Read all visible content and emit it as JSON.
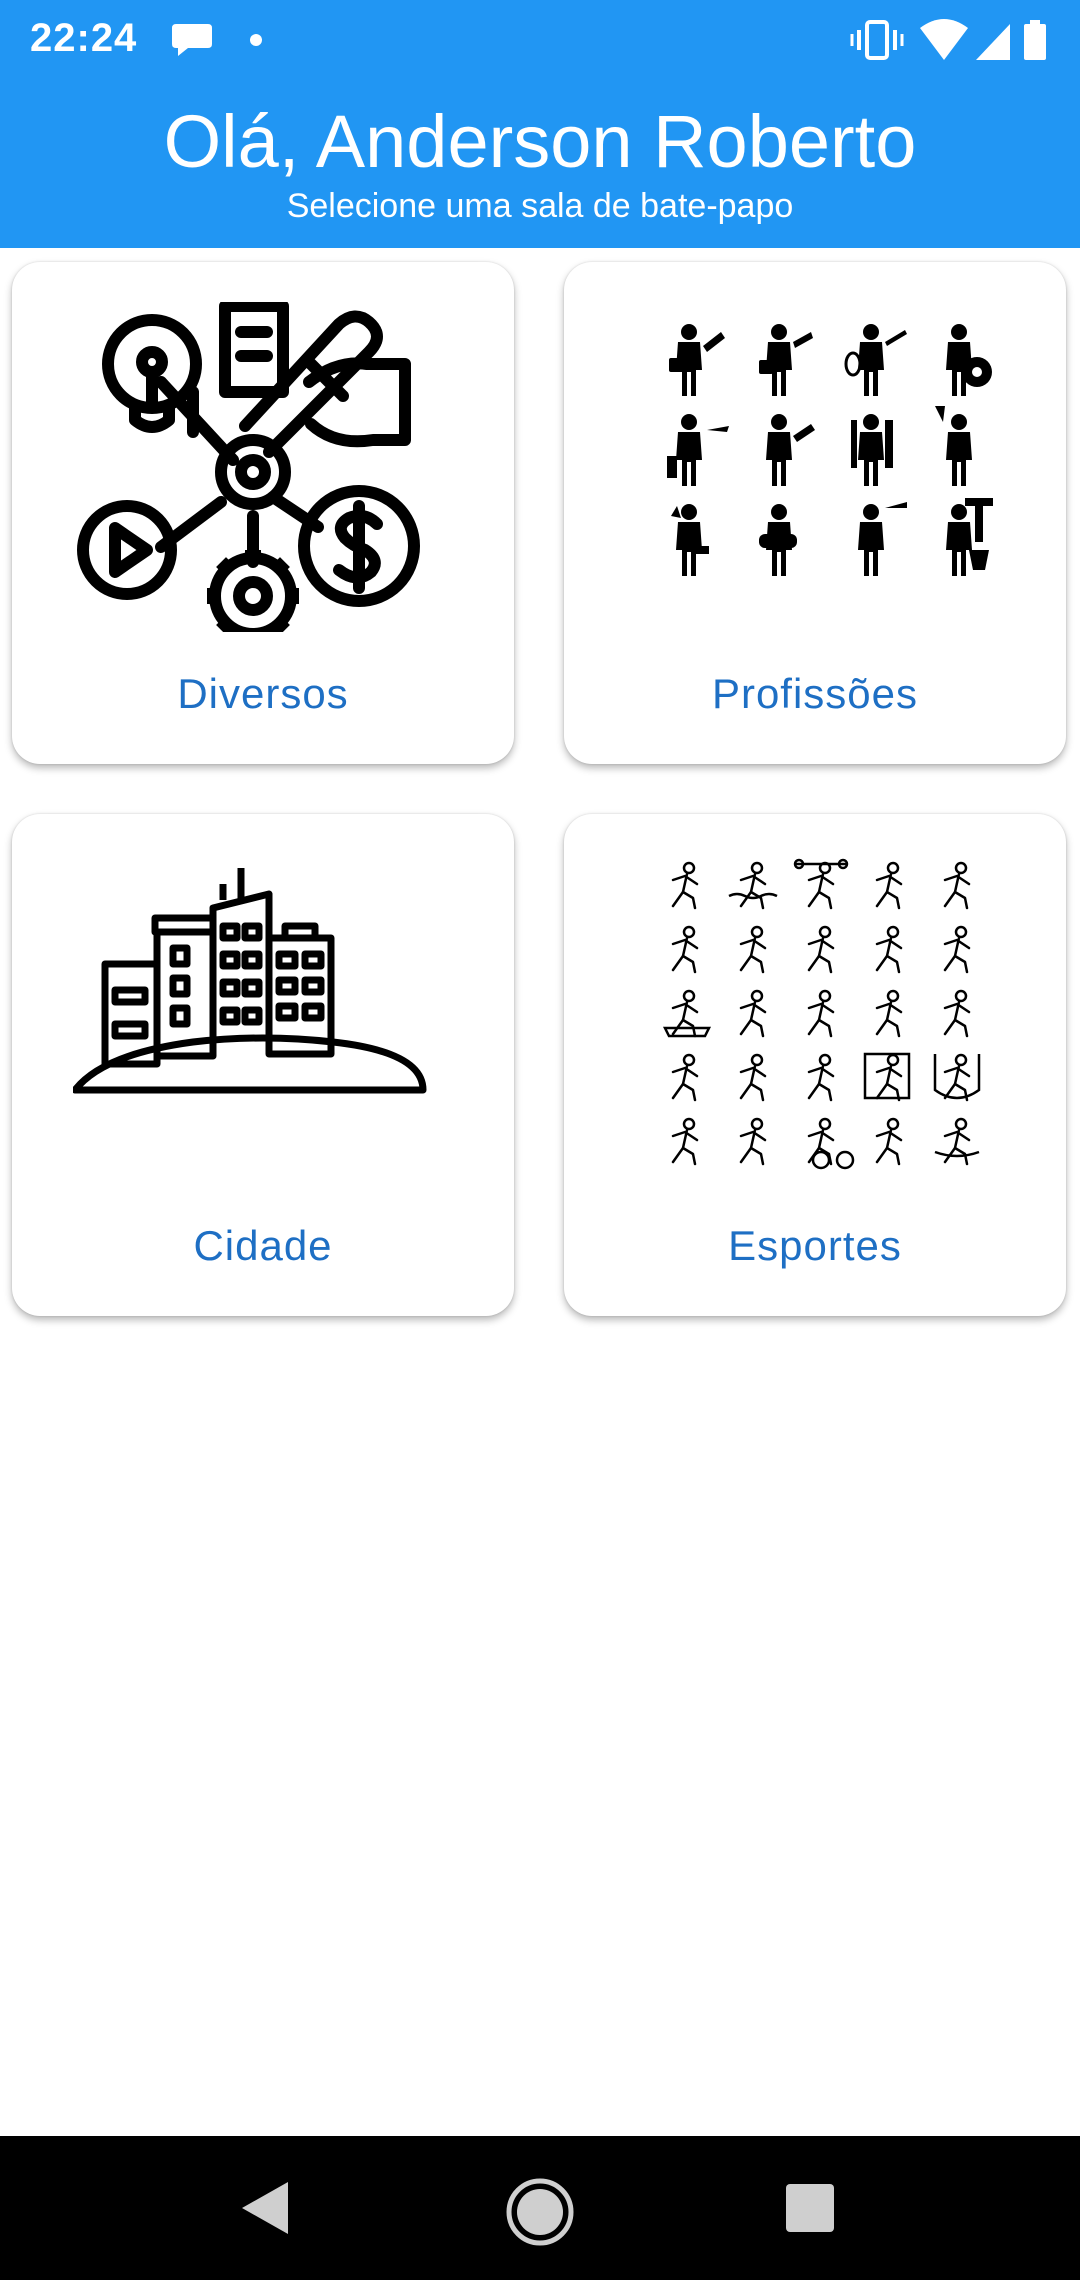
{
  "status_bar": {
    "time": "22:24",
    "icons": [
      "chat-bubble-icon",
      "notification-dot-icon",
      "vibrate-icon",
      "wifi-icon",
      "signal-icon",
      "battery-icon"
    ]
  },
  "header": {
    "greeting": "Olá, Anderson Roberto",
    "subtitle": "Selecione uma sala de bate-papo",
    "background_color": "#2196f3"
  },
  "rooms": [
    {
      "label": "Diversos",
      "icon": "network-hub-icon"
    },
    {
      "label": "Profissões",
      "icon": "professions-grid-icon"
    },
    {
      "label": "Cidade",
      "icon": "city-buildings-icon"
    },
    {
      "label": "Esportes",
      "icon": "sports-grid-icon"
    }
  ],
  "theme": {
    "accent": "#2196f3",
    "label_color": "#1e6fc4"
  },
  "nav_bar": {
    "buttons": [
      "back-icon",
      "home-icon",
      "recents-icon"
    ]
  }
}
